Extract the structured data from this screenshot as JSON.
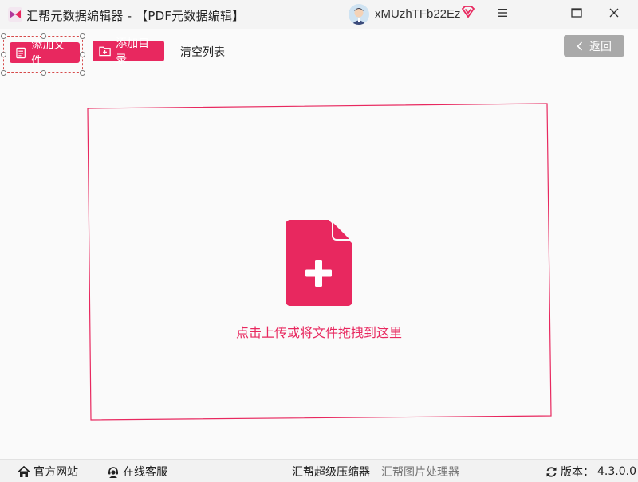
{
  "app": {
    "title": "汇帮元数据编辑器 - 【PDF元数据编辑】",
    "username": "xMUzhTFb22Ez",
    "brand_color": "#e8285f"
  },
  "window_controls": {
    "menu_icon": "hamburger-icon",
    "maximize_icon": "maximize-icon",
    "close_icon": "close-icon"
  },
  "toolbar": {
    "add_file_label": "添加文件",
    "add_dir_label": "添加目录",
    "clear_label": "清空列表",
    "back_label": "返回"
  },
  "dropzone": {
    "hint": "点击上传或将文件拖拽到这里",
    "icon": "file-add-icon"
  },
  "footer": {
    "site_label": "官方网站",
    "service_label": "在线客服",
    "compress_label": "汇帮超级压缩器",
    "image_label": "汇帮图片处理器",
    "version_label": "版本：",
    "version_value": "4.3.0.0"
  }
}
